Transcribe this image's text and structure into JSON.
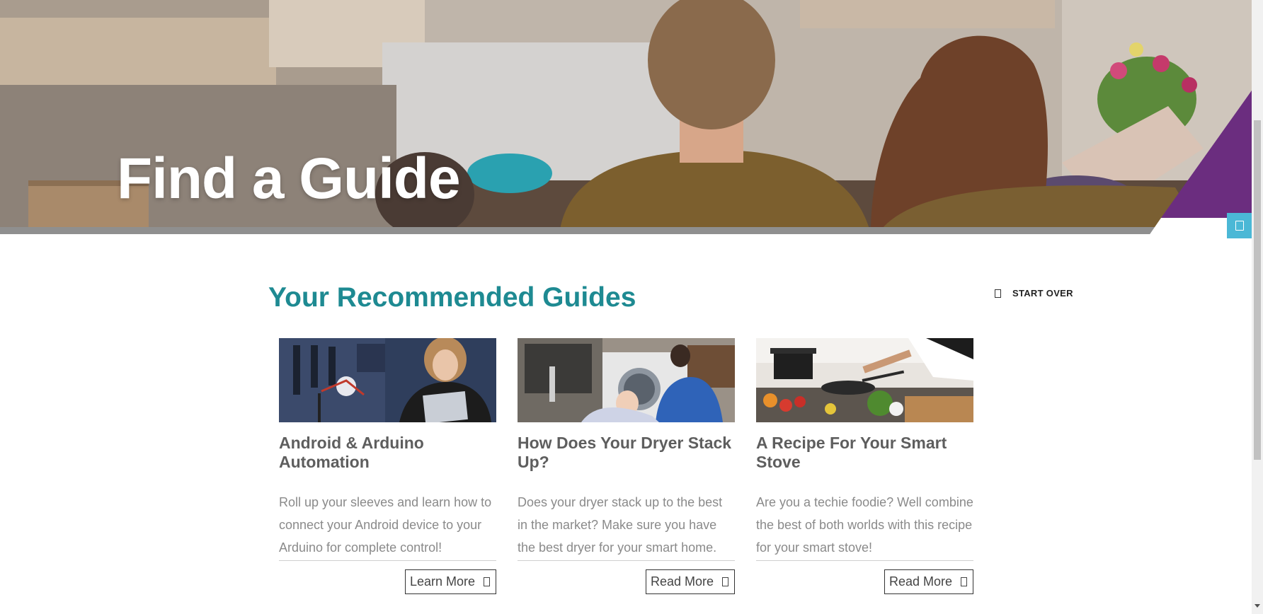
{
  "hero": {
    "title": "Find a Guide",
    "accent_color": "#6b2d7f"
  },
  "side_tab": {
    "icon": "chat-icon",
    "color": "#4bb8d6"
  },
  "section": {
    "title": "Your Recommended Guides",
    "title_color": "#1e8a92",
    "start_over_icon": "restart-icon",
    "start_over_label": "START OVER"
  },
  "guides": [
    {
      "image": "woman-with-tablet-and-arduino-robot",
      "title": "Android & Arduino Automation",
      "description": "Roll up your sleeves and learn how to connect your Android device to your Arduino for complete control!",
      "button_label": "Learn More",
      "button_icon": "arrow-icon"
    },
    {
      "image": "mother-and-baby-at-dryer",
      "title": "How Does Your Dryer Stack Up?",
      "description": "Does your dryer stack up to the best in the market? Make sure you have the best dryer for your smart home.",
      "button_label": "Read More",
      "button_icon": "arrow-icon"
    },
    {
      "image": "chef-cooking-on-stove",
      "title": "A Recipe For Your Smart Stove",
      "description": "Are you a techie foodie? Well combine the best of both worlds with this recipe for your smart stove!",
      "button_label": "Read More",
      "button_icon": "arrow-icon"
    }
  ]
}
